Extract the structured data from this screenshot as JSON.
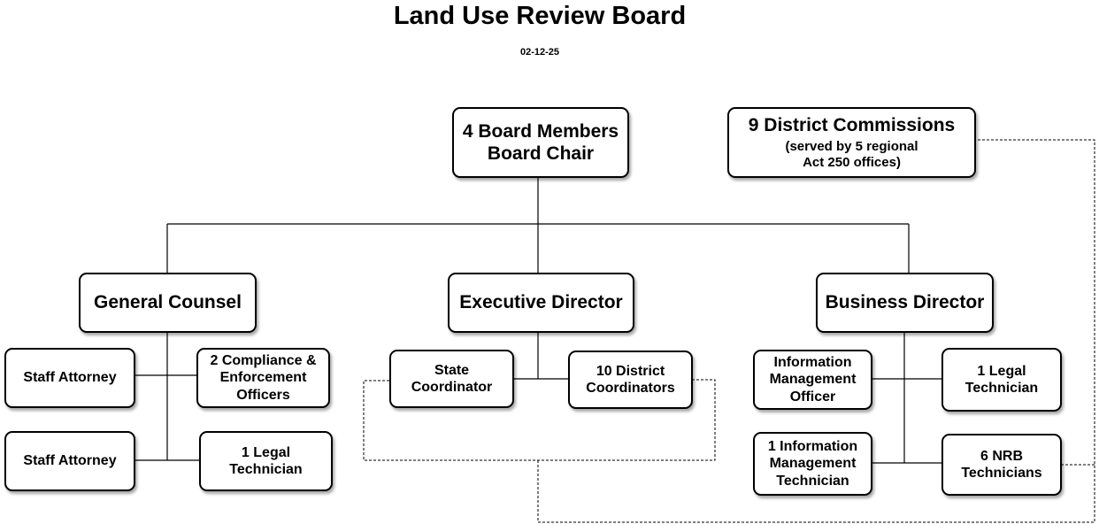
{
  "header": {
    "title": "Land Use Review Board",
    "date": "02-12-25"
  },
  "nodes": {
    "board": {
      "lines": [
        "4 Board Members",
        "Board Chair"
      ]
    },
    "district_commissions": {
      "title": "9 District Commissions",
      "sub": [
        "(served by 5 regional",
        "Act 250 offices)"
      ]
    },
    "general_counsel": {
      "lines": [
        "General Counsel"
      ]
    },
    "executive_director": {
      "lines": [
        "Executive Director"
      ]
    },
    "business_director": {
      "lines": [
        "Business Director"
      ]
    },
    "staff_attorney_1": {
      "lines": [
        "Staff Attorney"
      ]
    },
    "staff_attorney_2": {
      "lines": [
        "Staff Attorney"
      ]
    },
    "compliance_officers": {
      "lines": [
        "2 Compliance &",
        "Enforcement",
        "Officers"
      ]
    },
    "gc_legal_technician": {
      "lines": [
        "1 Legal",
        "Technician"
      ]
    },
    "state_coordinator": {
      "lines": [
        "State",
        "Coordinator"
      ]
    },
    "district_coordinators": {
      "lines": [
        "10 District",
        "Coordinators"
      ]
    },
    "info_mgmt_officer": {
      "lines": [
        "Information",
        "Management",
        "Officer"
      ]
    },
    "bd_legal_technician": {
      "lines": [
        "1 Legal",
        "Technician"
      ]
    },
    "info_mgmt_technician": {
      "lines": [
        "1 Information",
        "Management",
        "Technician"
      ]
    },
    "nrb_technicians": {
      "lines": [
        "6 NRB",
        "Technicians"
      ]
    }
  },
  "colors": {
    "line": "#000000",
    "box_fill": "#ffffff",
    "box_border": "#000000"
  }
}
